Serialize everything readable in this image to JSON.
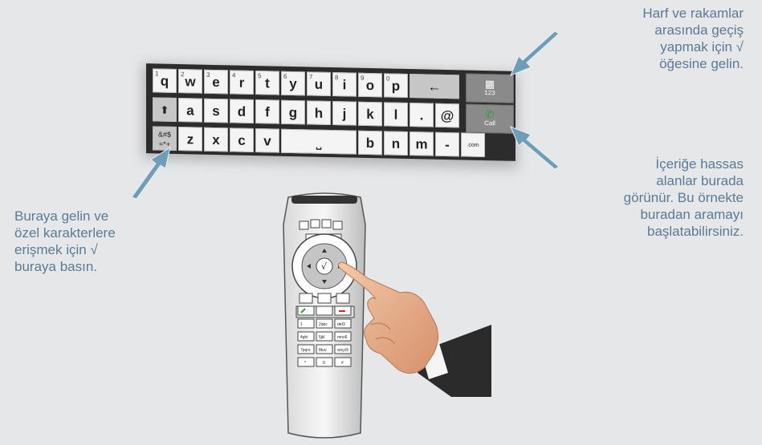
{
  "callouts": {
    "top_right": [
      "Harf ve rakamlar",
      "arasında geçiş",
      "yapmak için √",
      "öğesine gelin."
    ],
    "middle_right": [
      "İçeriğe hassas",
      "alanlar burada",
      "görünür. Bu örnekte",
      "buradan aramayı",
      "başlatabilirsiniz."
    ],
    "left": [
      "Buraya gelin ve",
      "özel karakterlere",
      "erişmek için √",
      "buraya basın."
    ]
  },
  "keyboard": {
    "row1": [
      {
        "label": "q",
        "num": "1"
      },
      {
        "label": "w",
        "num": "2"
      },
      {
        "label": "e",
        "num": "3"
      },
      {
        "label": "r",
        "num": "4"
      },
      {
        "label": "t",
        "num": "5"
      },
      {
        "label": "y",
        "num": "6"
      },
      {
        "label": "u",
        "num": "7"
      },
      {
        "label": "i",
        "num": "8"
      },
      {
        "label": "o",
        "num": "9"
      },
      {
        "label": "p",
        "num": "0"
      }
    ],
    "backspace": "←",
    "row2": [
      "a",
      "s",
      "d",
      "f",
      "g",
      "h",
      "j",
      "k",
      "l",
      ".",
      "@"
    ],
    "shift": "⬆",
    "row3": [
      "z",
      "x",
      "c",
      "v",
      "b",
      "n",
      "m",
      "-"
    ],
    "symbols_top": "&#$",
    "symbols_bottom": "=*+",
    "space": "⎵",
    "com": ".com",
    "side_123": "123",
    "side_call": "Call"
  },
  "remote": {
    "center": "√",
    "numpad": [
      [
        "1",
        "2abc",
        "def3"
      ],
      [
        "4ghi",
        "5jkl",
        "mno6"
      ],
      [
        "7pqrs",
        "8tuv",
        "wxyz9"
      ],
      [
        "*",
        "0",
        "#"
      ]
    ]
  },
  "icons": [
    "grid-icon",
    "phone-icon",
    "shift-icon",
    "backspace-icon",
    "check-icon",
    "home-icon",
    "phonebook-icon"
  ],
  "colors": {
    "callout_text": "#5a7a96",
    "arrow": "#6f9cb6",
    "call_green": "#2a9d3e"
  }
}
